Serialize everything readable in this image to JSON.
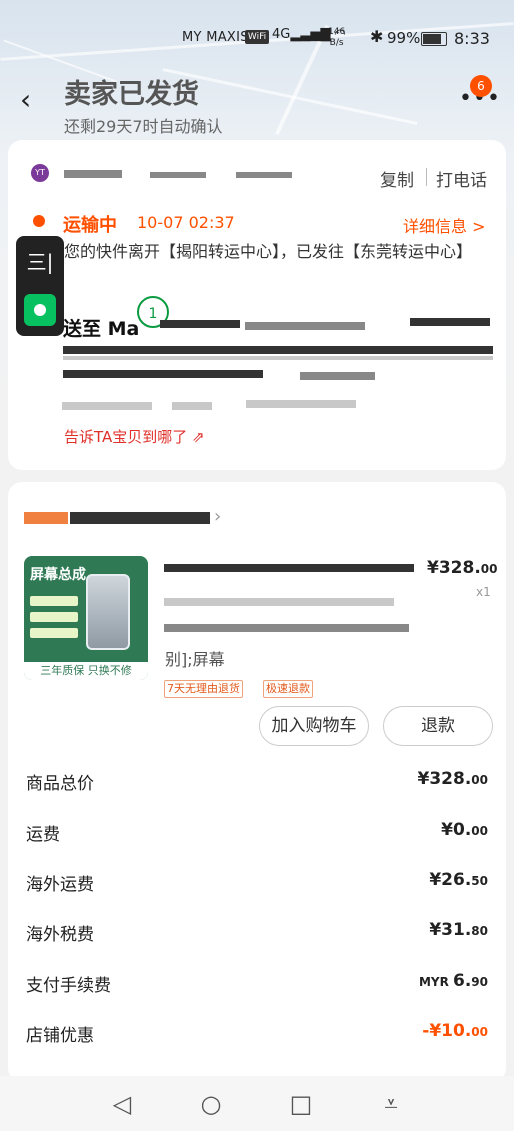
{
  "status_bar": {
    "carrier": "MY MAXIS",
    "wifi_badge": "WiFi",
    "network": "4G",
    "speed": "146",
    "speed_unit": "B/s",
    "battery": "99%",
    "time": "8:33"
  },
  "header": {
    "title": "卖家已发货",
    "subtitle": "还剩29天7时自动确认",
    "badge_count": "6"
  },
  "shipping": {
    "copy_label": "复制",
    "call_label": "打电话",
    "status": "运输中",
    "time": "10-07 02:37",
    "detail_link": "详细信息 >",
    "description": "您的快件离开【揭阳转运中心】，已发往【东莞转运中心】",
    "deliver_to": "送至 Ma",
    "widget_label": "三|",
    "tell_link": "告诉TA宝贝到哪了 ⇗"
  },
  "product": {
    "image_title": "屏幕总成",
    "image_footer": "三年质保 只换不修",
    "price_main": "¥328.",
    "price_cents": "00",
    "quantity": "x1",
    "variant_tail": "别];屏幕",
    "tags": [
      "7天无理由退货",
      "极速退款"
    ],
    "add_to_cart": "加入购物车",
    "refund": "退款"
  },
  "fees": [
    {
      "label": "商品总价",
      "cur": "",
      "main": "¥328.",
      "cents": "00"
    },
    {
      "label": "运费",
      "cur": "",
      "main": "¥0.",
      "cents": "00"
    },
    {
      "label": "海外运费",
      "cur": "",
      "main": "¥26.",
      "cents": "50"
    },
    {
      "label": "海外税费",
      "cur": "",
      "main": "¥31.",
      "cents": "80"
    },
    {
      "label": "支付手续费",
      "cur": "MYR ",
      "main": "6.",
      "cents": "90"
    },
    {
      "label": "店铺优惠",
      "cur": "",
      "main": "-¥10.",
      "cents": "00"
    }
  ],
  "colors": {
    "accent": "#ff5000",
    "link_red": "#e0302a",
    "widget_green": "#07c160"
  },
  "icons": {
    "back": "chevron-left-icon",
    "more": "more-dots-icon",
    "nav": [
      "back-triangle-icon",
      "home-circle-icon",
      "recents-square-icon",
      "notification-pull-icon"
    ]
  }
}
